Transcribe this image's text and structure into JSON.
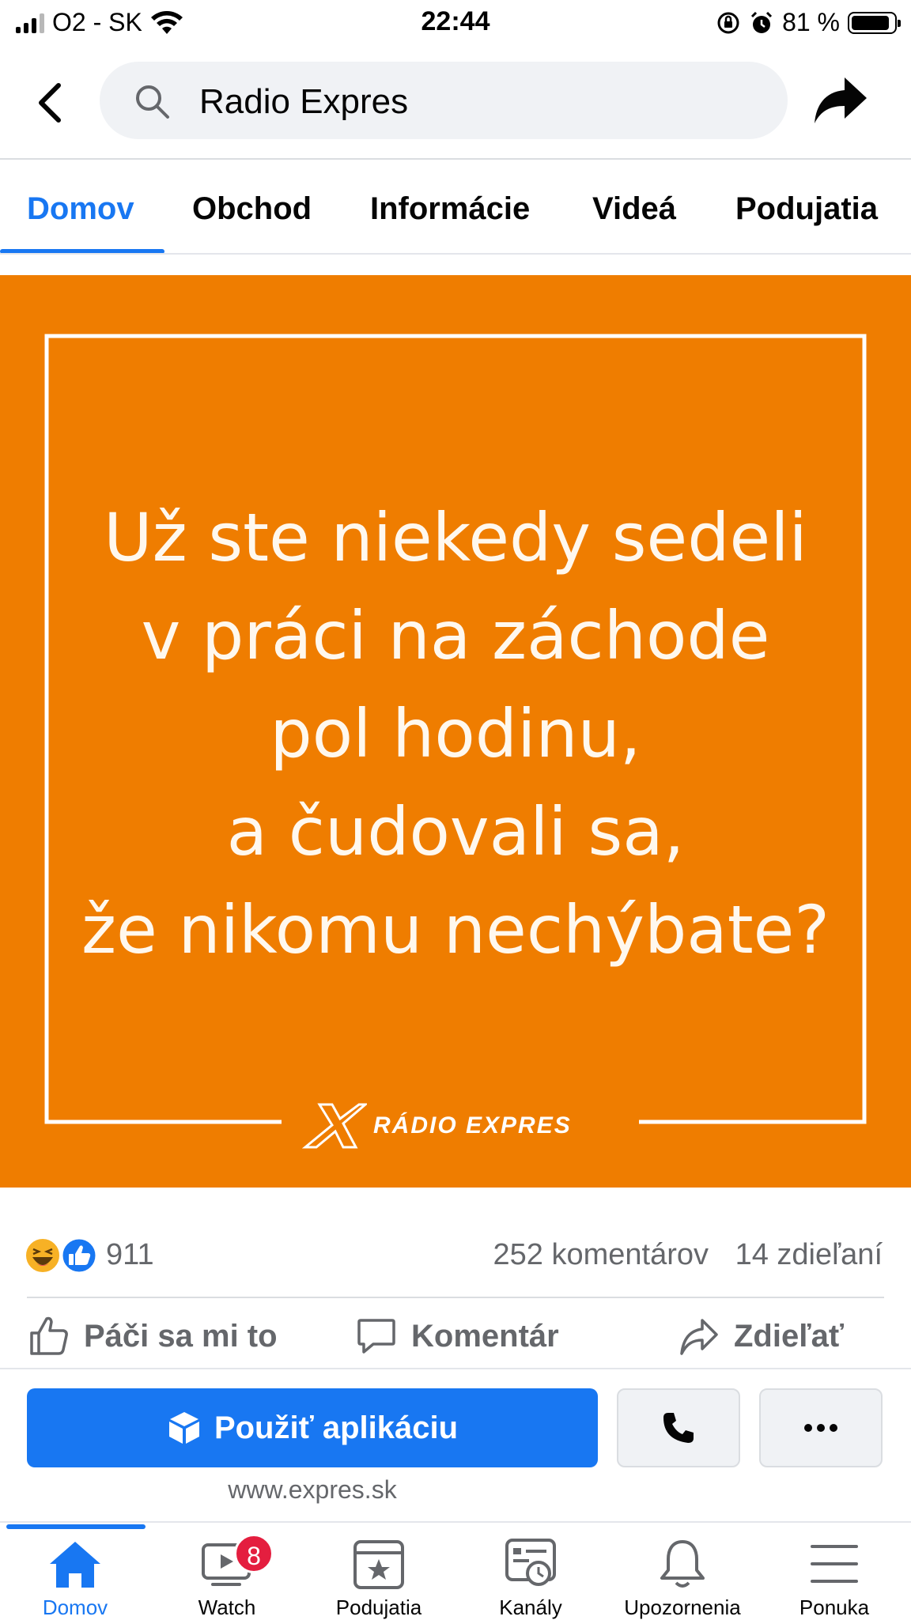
{
  "status_bar": {
    "carrier": "O2 - SK",
    "time": "22:44",
    "battery": "81 %",
    "battery_level": 0.81
  },
  "header": {
    "search_text": "Radio Expres"
  },
  "tabs": [
    {
      "label": "Domov",
      "active": true
    },
    {
      "label": "Obchod",
      "active": false
    },
    {
      "label": "Informácie",
      "active": false
    },
    {
      "label": "Videá",
      "active": false
    },
    {
      "label": "Podujatia",
      "active": false
    }
  ],
  "post": {
    "image_bg": "#ef7d00",
    "quote_lines": [
      "Už ste niekedy sedeli",
      "v práci na záchode",
      "pol hodinu,",
      "a čudovali sa,",
      "že nikomu nechýbate?"
    ],
    "logo_text": "RÁDIO EXPRES"
  },
  "reactions": {
    "icons": [
      "haha-reaction-icon",
      "like-reaction-icon"
    ],
    "count": "911",
    "comments": "252 komentárov",
    "shares": "14 zdieľaní"
  },
  "actions": {
    "like": "Páči sa mi to",
    "comment": "Komentár",
    "share": "Zdieľať"
  },
  "cta": {
    "primary": "Použiť aplikáciu",
    "url": "www.expres.sk",
    "accent": "#1877f2"
  },
  "bottom_nav": {
    "items": [
      {
        "label": "Domov",
        "icon": "home-icon"
      },
      {
        "label": "Watch",
        "icon": "watch-icon",
        "badge": "8"
      },
      {
        "label": "Podujatia",
        "icon": "events-icon"
      },
      {
        "label": "Kanály",
        "icon": "feeds-icon"
      },
      {
        "label": "Upozornenia",
        "icon": "bell-icon"
      },
      {
        "label": "Ponuka",
        "icon": "menu-icon"
      }
    ]
  }
}
